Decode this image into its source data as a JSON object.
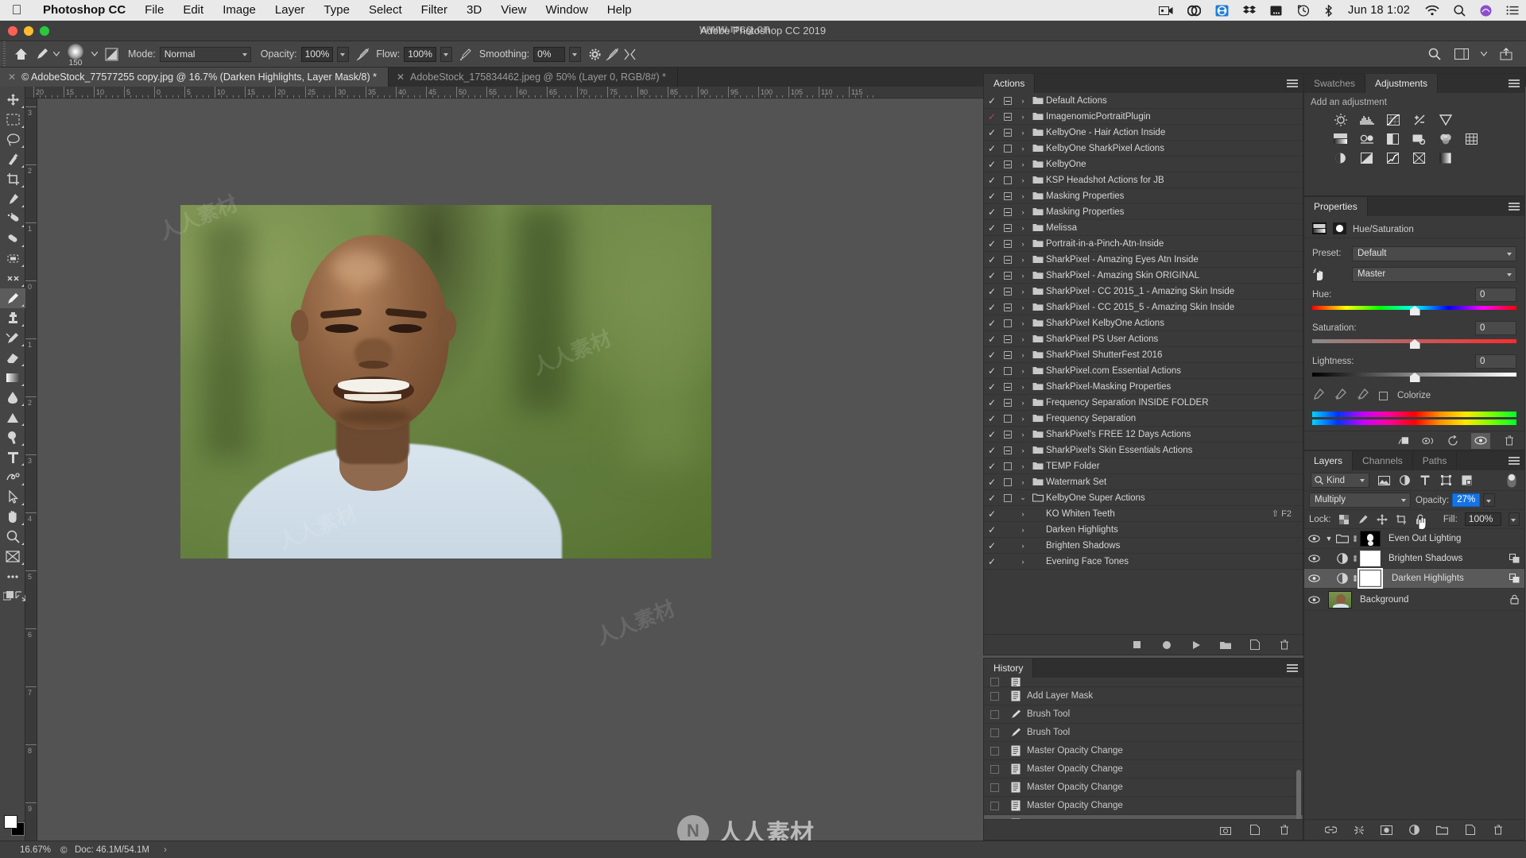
{
  "app": {
    "name": "Photoshop CC",
    "window_title": "Adobe Photoshop CC 2019"
  },
  "macbar": {
    "apple": "apple-logo",
    "menus": [
      "Photoshop CC",
      "File",
      "Edit",
      "Image",
      "Layer",
      "Type",
      "Select",
      "Filter",
      "3D",
      "View",
      "Window",
      "Help"
    ],
    "status_icons": [
      "screen-recorder-icon",
      "creative-cloud-icon",
      "arrows-icon",
      "dropbox-icon",
      "battery-icon",
      "time-machine-icon",
      "bluetooth-icon"
    ],
    "clock": "Jun 18  1:02",
    "right_icons": [
      "wifi-icon",
      "spotlight-search-icon",
      "siri-icon",
      "control-center-icon"
    ]
  },
  "options_bar": {
    "home_icon": "home-icon",
    "tool_preset": "brush-preset",
    "brush_size": "150",
    "mode_label": "Mode:",
    "mode_value": "Normal",
    "opacity_label": "Opacity:",
    "opacity_value": "100%",
    "pressure_opacity_icon": "pressure-opacity-icon",
    "flow_label": "Flow:",
    "flow_value": "100%",
    "airbrush_icon": "airbrush-icon",
    "smoothing_label": "Smoothing:",
    "smoothing_value": "0%",
    "smoothing_gear_icon": "gear-icon",
    "pressure_size_icon": "pressure-size-icon",
    "symmetry_icon": "symmetry-icon",
    "right_icons": [
      "search-icon",
      "workspace-icon",
      "share-icon"
    ]
  },
  "tabs": [
    {
      "title": "© AdobeStock_77577255 copy.jpg @ 16.7% (Darken Highlights, Layer Mask/8) *",
      "active": true
    },
    {
      "title": "AdobeStock_175834462.jpeg @ 50% (Layer 0, RGB/8#) *",
      "active": false
    }
  ],
  "toolbar": [
    "move-tool",
    "rectangular-marquee-tool",
    "lasso-tool",
    "quick-selection-tool",
    "crop-tool",
    "eyedropper-tool",
    "spot-healing-brush-tool",
    "patch-tool",
    "content-aware-move-tool",
    "clone-source-tool",
    "brush-tool",
    "clone-stamp-tool",
    "history-brush-tool",
    "eraser-tool",
    "gradient-tool",
    "blur-tool",
    "dodge-tool",
    "sharpen-tool",
    "type-tool",
    "pen-tool",
    "path-selection-tool",
    "hand-tool",
    "zoom-tool",
    "frame-tool",
    "edit-toolbar-tool",
    "quick-mask-tool",
    "screen-mode-tool"
  ],
  "rulers": {
    "horizontal": [
      "20",
      "15",
      "10",
      "5",
      "0",
      "5",
      "10",
      "15",
      "20",
      "25",
      "30",
      "35",
      "40",
      "45",
      "50",
      "55",
      "60",
      "65",
      "70",
      "75",
      "80",
      "85",
      "90",
      "95",
      "100",
      "105",
      "110",
      "115"
    ],
    "vertical": [
      "3",
      "2",
      "1",
      "0",
      "1",
      "2",
      "3",
      "4",
      "5",
      "6",
      "7",
      "8",
      "9"
    ]
  },
  "status_bar": {
    "zoom": "16.67%",
    "doc_icon": "copyright-icon",
    "doc": "Doc: 46.1M/54.1M",
    "arrow": "›"
  },
  "actions_panel": {
    "tab": "Actions",
    "menu_icon": "panel-menu-icon",
    "rows": [
      {
        "name": "Default Actions",
        "checked": true,
        "checked_red": false,
        "box": "minus",
        "expanded": false,
        "type": "set"
      },
      {
        "name": "ImagenomicPortraitPlugin",
        "checked": true,
        "checked_red": true,
        "box": "minus",
        "expanded": false,
        "type": "set"
      },
      {
        "name": "KelbyOne - Hair Action Inside",
        "checked": true,
        "checked_red": false,
        "box": "minus",
        "expanded": false,
        "type": "set"
      },
      {
        "name": "KelbyOne SharkPixel Actions",
        "checked": true,
        "checked_red": false,
        "box": "empty",
        "expanded": false,
        "type": "set"
      },
      {
        "name": "KelbyOne",
        "checked": true,
        "checked_red": false,
        "box": "minus",
        "expanded": false,
        "type": "set"
      },
      {
        "name": "KSP Headshot Actions for JB",
        "checked": true,
        "checked_red": false,
        "box": "empty",
        "expanded": false,
        "type": "set"
      },
      {
        "name": "Masking Properties",
        "checked": true,
        "checked_red": false,
        "box": "minus",
        "expanded": false,
        "type": "set"
      },
      {
        "name": "Masking Properties",
        "checked": true,
        "checked_red": false,
        "box": "minus",
        "expanded": false,
        "type": "set"
      },
      {
        "name": "Melissa",
        "checked": true,
        "checked_red": false,
        "box": "minus",
        "expanded": false,
        "type": "set"
      },
      {
        "name": "Portrait-in-a-Pinch-Atn-Inside",
        "checked": true,
        "checked_red": false,
        "box": "minus",
        "expanded": false,
        "type": "set"
      },
      {
        "name": "SharkPixel - Amazing Eyes Atn Inside",
        "checked": true,
        "checked_red": false,
        "box": "minus",
        "expanded": false,
        "type": "set"
      },
      {
        "name": "SharkPixel - Amazing Skin ORIGINAL",
        "checked": true,
        "checked_red": false,
        "box": "minus",
        "expanded": false,
        "type": "set"
      },
      {
        "name": "SharkPixel - CC 2015_1 - Amazing Skin Inside",
        "checked": true,
        "checked_red": false,
        "box": "minus",
        "expanded": false,
        "type": "set"
      },
      {
        "name": "SharkPixel - CC 2015_5 - Amazing Skin Inside",
        "checked": true,
        "checked_red": false,
        "box": "minus",
        "expanded": false,
        "type": "set"
      },
      {
        "name": "SharkPixel KelbyOne Actions",
        "checked": true,
        "checked_red": false,
        "box": "empty",
        "expanded": false,
        "type": "set"
      },
      {
        "name": "SharkPixel PS User Actions",
        "checked": true,
        "checked_red": false,
        "box": "minus",
        "expanded": false,
        "type": "set"
      },
      {
        "name": "SharkPixel ShutterFest 2016",
        "checked": true,
        "checked_red": false,
        "box": "minus",
        "expanded": false,
        "type": "set"
      },
      {
        "name": "SharkPixel.com Essential Actions",
        "checked": true,
        "checked_red": false,
        "box": "empty",
        "expanded": false,
        "type": "set"
      },
      {
        "name": "SharkPixel-Masking Properties",
        "checked": true,
        "checked_red": false,
        "box": "minus",
        "expanded": false,
        "type": "set"
      },
      {
        "name": "Frequency Separation INSIDE FOLDER",
        "checked": true,
        "checked_red": false,
        "box": "minus",
        "expanded": false,
        "type": "set"
      },
      {
        "name": "Frequency Separation",
        "checked": true,
        "checked_red": false,
        "box": "empty",
        "expanded": false,
        "type": "set"
      },
      {
        "name": "SharkPixel's FREE 12 Days Actions",
        "checked": true,
        "checked_red": false,
        "box": "minus",
        "expanded": false,
        "type": "set"
      },
      {
        "name": "SharkPixel's Skin Essentials Actions",
        "checked": true,
        "checked_red": false,
        "box": "minus",
        "expanded": false,
        "type": "set"
      },
      {
        "name": "TEMP Folder",
        "checked": true,
        "checked_red": false,
        "box": "empty",
        "expanded": false,
        "type": "set"
      },
      {
        "name": "Watermark Set",
        "checked": true,
        "checked_red": false,
        "box": "empty",
        "expanded": false,
        "type": "set"
      },
      {
        "name": "KelbyOne Super Actions",
        "checked": true,
        "checked_red": false,
        "box": "empty",
        "expanded": true,
        "type": "set"
      },
      {
        "name": "KO Whiten Teeth",
        "checked": true,
        "checked_red": false,
        "box": "empty",
        "expanded": false,
        "type": "action",
        "shortcut": "⇧ F2"
      },
      {
        "name": "Darken Highlights",
        "checked": true,
        "checked_red": false,
        "box": "empty",
        "expanded": false,
        "type": "action",
        "shortcut": ""
      },
      {
        "name": "Brighten Shadows",
        "checked": true,
        "checked_red": false,
        "box": "empty",
        "expanded": false,
        "type": "action",
        "shortcut": ""
      },
      {
        "name": "Evening Face Tones",
        "checked": true,
        "checked_red": false,
        "box": "empty",
        "expanded": false,
        "type": "action",
        "shortcut": ""
      }
    ],
    "footer_icons": [
      "stop-icon",
      "record-icon",
      "play-icon",
      "new-set-icon",
      "new-action-icon",
      "delete-icon"
    ]
  },
  "history_panel": {
    "tab": "History",
    "menu_icon": "panel-menu-icon",
    "rows": [
      {
        "name": "",
        "icon": "document-icon",
        "selected": false,
        "partial": true
      },
      {
        "name": "Add Layer Mask",
        "icon": "document-icon",
        "selected": false
      },
      {
        "name": "Brush Tool",
        "icon": "brush-icon",
        "selected": false
      },
      {
        "name": "Brush Tool",
        "icon": "brush-icon",
        "selected": false
      },
      {
        "name": "Master Opacity Change",
        "icon": "document-icon",
        "selected": false
      },
      {
        "name": "Master Opacity Change",
        "icon": "document-icon",
        "selected": false
      },
      {
        "name": "Master Opacity Change",
        "icon": "document-icon",
        "selected": false
      },
      {
        "name": "Master Opacity Change",
        "icon": "document-icon",
        "selected": false
      },
      {
        "name": "Master Opacity Change",
        "icon": "document-icon",
        "selected": true
      }
    ],
    "footer_icons": [
      "snapshot-icon",
      "new-document-icon",
      "delete-icon"
    ]
  },
  "adjustments_panel": {
    "tabs": [
      {
        "label": "Swatches",
        "active": false
      },
      {
        "label": "Adjustments",
        "active": true
      }
    ],
    "menu_icon": "panel-menu-icon",
    "heading": "Add an adjustment",
    "row1": [
      "brightness-contrast-icon",
      "levels-icon",
      "curves-icon",
      "exposure-icon",
      "vibrance-icon"
    ],
    "row2": [
      "hue-saturation-icon",
      "color-balance-icon",
      "black-white-icon",
      "photo-filter-icon",
      "channel-mixer-icon",
      "color-lookup-icon"
    ],
    "row3": [
      "invert-icon",
      "posterize-icon",
      "threshold-icon",
      "selective-color-icon",
      "gradient-map-icon"
    ]
  },
  "properties_panel": {
    "tab": "Properties",
    "menu_icon": "panel-menu-icon",
    "adjustment_icon": "hue-saturation-icon",
    "mask_icon": "layer-mask-icon",
    "title": "Hue/Saturation",
    "preset_label": "Preset:",
    "preset_value": "Default",
    "hand_icon": "targeted-adjustment-icon",
    "channel_value": "Master",
    "hue_label": "Hue:",
    "hue_value": "0",
    "saturation_label": "Saturation:",
    "saturation_value": "0",
    "lightness_label": "Lightness:",
    "lightness_value": "0",
    "eyedroppers": [
      "eyedropper-icon",
      "eyedropper-add-icon",
      "eyedropper-subtract-icon"
    ],
    "colorize_label": "Colorize",
    "colorize_checked": false,
    "footer_icons": [
      "clip-to-layer-icon",
      "view-previous-icon",
      "reset-icon",
      "toggle-visibility-icon",
      "delete-icon"
    ]
  },
  "layers_panel": {
    "tabs": [
      {
        "label": "Layers",
        "active": true
      },
      {
        "label": "Channels",
        "active": false
      },
      {
        "label": "Paths",
        "active": false
      }
    ],
    "menu_icon": "panel-menu-icon",
    "filter_kind": "Kind",
    "filter_icons": [
      "filter-pixel-icon",
      "filter-adjustment-icon",
      "filter-type-icon",
      "filter-shape-icon",
      "filter-smart-object-icon"
    ],
    "filter_toggle": "filter-toggle-icon",
    "blend_mode": "Multiply",
    "opacity_label": "Opacity:",
    "opacity_value": "27%",
    "lock_label": "Lock:",
    "lock_icons": [
      "lock-transparent-icon",
      "lock-image-icon",
      "lock-position-icon",
      "lock-artboard-icon",
      "lock-all-icon"
    ],
    "fill_label": "Fill:",
    "fill_value": "100%",
    "rows": [
      {
        "name": "Even Out Lighting",
        "type": "group",
        "visible": true,
        "selected": false,
        "mask": "black-white-mask",
        "expanded": true
      },
      {
        "name": "Brighten Shadows",
        "type": "adjustment",
        "visible": true,
        "selected": false,
        "mask": "white-mask",
        "clipped": true
      },
      {
        "name": "Darken Highlights",
        "type": "adjustment",
        "visible": true,
        "selected": true,
        "mask": "white-mask-active",
        "clipped": true
      },
      {
        "name": "Background",
        "type": "image",
        "visible": true,
        "selected": false,
        "locked": true
      }
    ],
    "footer_icons": [
      "link-layers-icon",
      "layer-style-icon",
      "add-mask-icon",
      "new-fill-adjustment-icon",
      "new-group-icon",
      "new-layer-icon",
      "delete-layer-icon"
    ]
  },
  "watermarks": {
    "url": "www.rrcg.cn",
    "site_name": "人人素材",
    "badge": "N"
  },
  "colors": {
    "accent_blue": "#1473e6",
    "panel_bg": "#3a3a3a",
    "app_bg": "#535353",
    "toolbar_bg": "#454545",
    "tab_bg": "#2f2f2f",
    "text": "#d6d6d6",
    "red_check": "#cf4040"
  }
}
